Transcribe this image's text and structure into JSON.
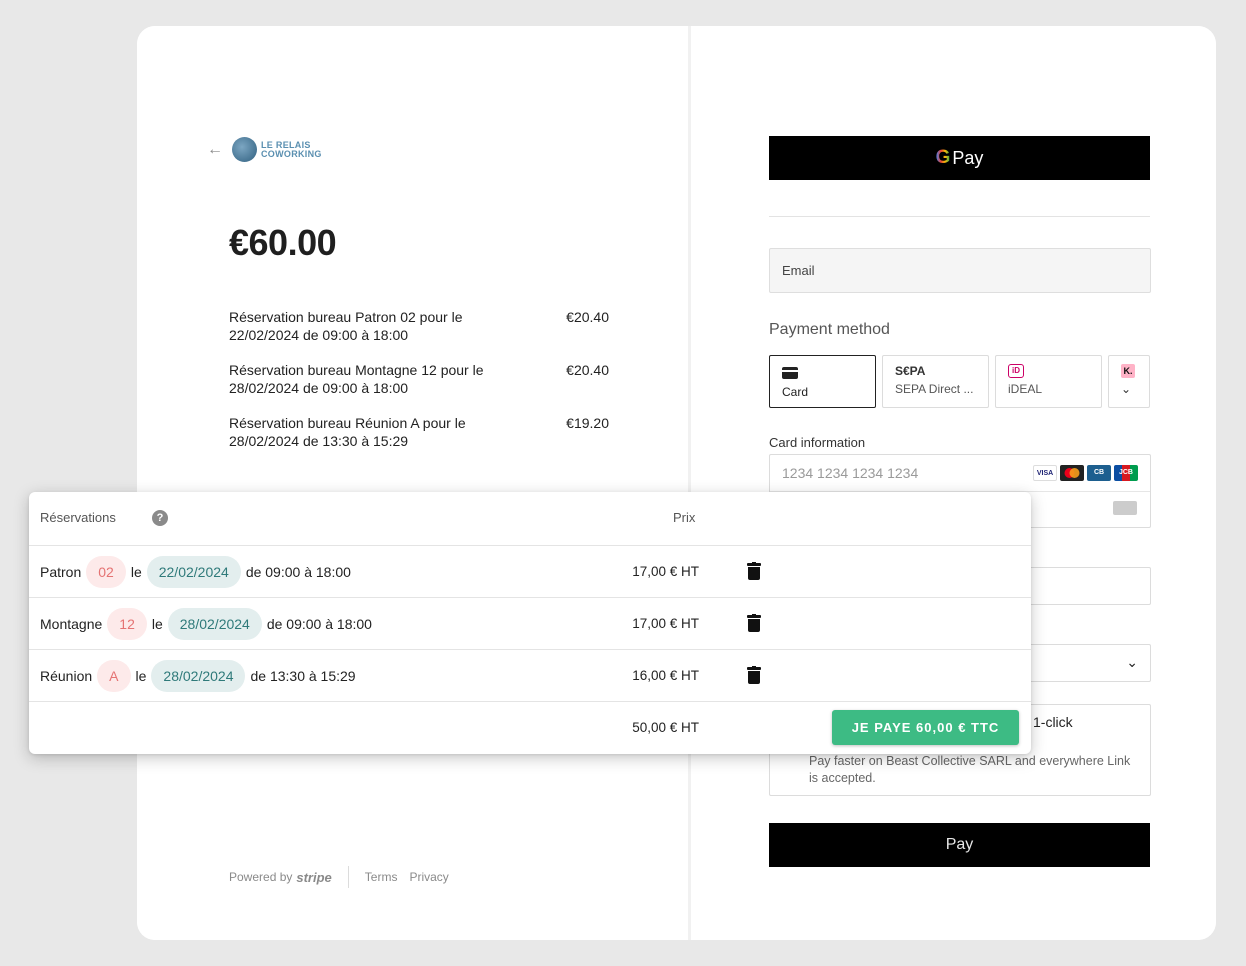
{
  "checkout": {
    "logo_line1": "LE RELAIS",
    "logo_line2": "COWORKING",
    "amount": "€60.00",
    "line_items": [
      {
        "desc_line1": "Réservation bureau Patron 02 pour le",
        "desc_line2": "22/02/2024 de 09:00 à 18:00",
        "price": "€20.40"
      },
      {
        "desc_line1": "Réservation bureau Montagne 12 pour le",
        "desc_line2": "28/02/2024 de 09:00 à 18:00",
        "price": "€20.40"
      },
      {
        "desc_line1": "Réservation bureau Réunion A pour le",
        "desc_line2": "28/02/2024 de 13:30 à 15:29",
        "price": "€19.20"
      }
    ],
    "footer": {
      "powered": "Powered by",
      "brand": "stripe",
      "terms": "Terms",
      "privacy": "Privacy"
    }
  },
  "payment": {
    "gpay_g": "G",
    "gpay_label": "Pay",
    "email_label": "Email",
    "method_title": "Payment method",
    "tabs": [
      {
        "label": "Card",
        "icon": "card-icon"
      },
      {
        "label": "SEPA Direct ...",
        "icon_text": "S€PA"
      },
      {
        "label": "iDEAL",
        "icon_text": "iD"
      },
      {
        "label": "",
        "icon_text": "K."
      }
    ],
    "card_info_label": "Card information",
    "card_number_placeholder": "1234 1234 1234 1234",
    "brands": [
      "VISA",
      "MC",
      "CB",
      "JCB"
    ],
    "link_title": "1-click",
    "link_text": "Pay faster on Beast Collective SARL and everywhere Link is accepted.",
    "pay_label": "Pay"
  },
  "overlay": {
    "header_title": "Réservations",
    "help": "?",
    "header_price": "Prix",
    "rows": [
      {
        "room": "Patron",
        "num": "02",
        "le": "le",
        "date": "22/02/2024",
        "time": "de 09:00 à 18:00",
        "price": "17,00 € HT"
      },
      {
        "room": "Montagne",
        "num": "12",
        "le": "le",
        "date": "28/02/2024",
        "time": "de 09:00 à 18:00",
        "price": "17,00 € HT"
      },
      {
        "room": "Réunion",
        "num": "A",
        "le": "le",
        "date": "28/02/2024",
        "time": "de 13:30 à 15:29",
        "price": "16,00 € HT"
      }
    ],
    "total": "50,00 € HT",
    "pay_button": "JE PAYE 60,00 € TTC"
  }
}
